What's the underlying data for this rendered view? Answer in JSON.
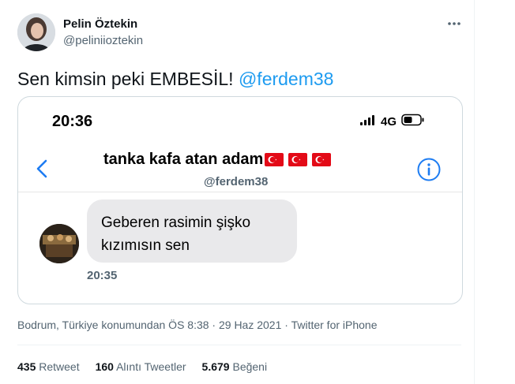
{
  "tweet": {
    "author_name": "Pelin Öztekin",
    "author_handle": "@peliniioztekin",
    "text": "Sen kimsin peki EMBESİL!",
    "mention": "@ferdem38",
    "more_icon": "more-horizontal-icon"
  },
  "screenshot": {
    "status_time": "20:36",
    "network": "4G",
    "chat_title": "tanka kafa atan adam",
    "chat_handle": "@ferdem38",
    "message_text": "Geberen rasimin şişko kızımısın sen",
    "message_time": "20:35",
    "colors": {
      "ios_blue": "#1d7cf2",
      "bubble": "#e9e9eb",
      "flag_red": "#e30a17"
    }
  },
  "meta": {
    "location_time": "Bodrum, Türkiye konumundan ÖS 8:38 · 29 Haz 2021 · ",
    "source": "Twitter for iPhone"
  },
  "stats": {
    "retweets_count": "435",
    "retweets_label": "Retweet",
    "quotes_count": "160",
    "quotes_label": "Alıntı Tweetler",
    "likes_count": "5.679",
    "likes_label": "Beğeni"
  }
}
